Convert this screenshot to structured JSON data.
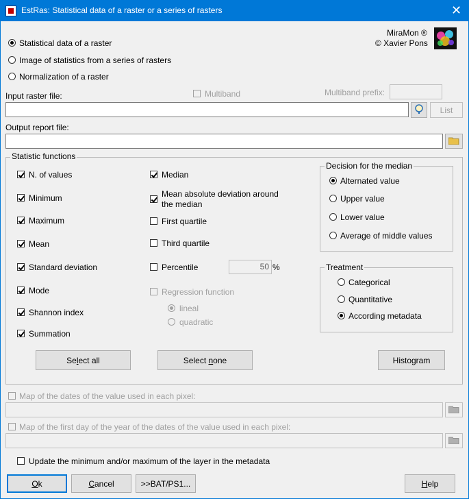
{
  "window": {
    "title": "EstRas: Statistical data of a raster or a series of rasters",
    "close_glyph": "✕"
  },
  "brand": {
    "line1": "MiraMon ®",
    "line2": "© Xavier Pons",
    "logo": "miramon-logo"
  },
  "mode": {
    "options": [
      {
        "label": "Statistical data of a raster",
        "selected": true
      },
      {
        "label": "Image of statistics from a series of rasters",
        "selected": false
      },
      {
        "label": "Normalization of a raster",
        "selected": false
      }
    ]
  },
  "input": {
    "label": "Input raster file:",
    "value": "",
    "multiband_label": "Multiband",
    "multiband_prefix_label": "Multiband prefix:",
    "multiband_prefix_value": "",
    "list_button": "List"
  },
  "output": {
    "label": "Output report file:",
    "value": ""
  },
  "stats": {
    "group_title": "Statistic functions",
    "col1": [
      {
        "label": "N. of values",
        "checked": true
      },
      {
        "label": "Minimum",
        "checked": true
      },
      {
        "label": "Maximum",
        "checked": true
      },
      {
        "label": "Mean",
        "checked": true
      },
      {
        "label": "Standard deviation",
        "checked": true
      },
      {
        "label": "Mode",
        "checked": true
      },
      {
        "label": "Shannon index",
        "checked": true
      },
      {
        "label": "Summation",
        "checked": true
      }
    ],
    "median": "Median",
    "mad_line1": "Mean absolute deviation around",
    "mad_line2": "the median",
    "first_quartile": "First quartile",
    "third_quartile": "Third quartile",
    "percentile": "Percentile",
    "percentile_value": "50",
    "percent_sign": "%",
    "regression": "Regression function",
    "lineal": "lineal",
    "quadratic": "quadratic",
    "select_all_pre": "Se",
    "select_all_ul": "l",
    "select_all_post": "ect all",
    "select_none_pre": "Select ",
    "select_none_ul": "n",
    "select_none_post": "one",
    "histogram": "Histogram"
  },
  "median_decision": {
    "title": "Decision for the median",
    "options": [
      {
        "label": "Alternated value",
        "selected": true
      },
      {
        "label": "Upper value",
        "selected": false
      },
      {
        "label": "Lower value",
        "selected": false
      },
      {
        "label": "Average of middle values",
        "selected": false
      }
    ]
  },
  "treatment": {
    "title": "Treatment",
    "options": [
      {
        "label": "Categorical",
        "selected": false
      },
      {
        "label": "Quantitative",
        "selected": false
      },
      {
        "label": "According metadata",
        "selected": true
      }
    ]
  },
  "dates": {
    "map_dates_label": "Map of the dates of the value used in each pixel:",
    "map_first_day_label": "Map of the first day of the year of the dates of the value used in each pixel:"
  },
  "update_metadata": "Update the minimum and/or maximum of the layer in the metadata",
  "footer": {
    "ok_ul": "O",
    "ok_rest": "k",
    "cancel_ul": "C",
    "cancel_rest": "ancel",
    "bat": ">>BAT/PS1...",
    "help_ul": "H",
    "help_rest": "elp"
  },
  "colors": {
    "titlebar": "#0078d7",
    "background": "#f0f0f0",
    "disabled_text": "#a0a0a0"
  }
}
